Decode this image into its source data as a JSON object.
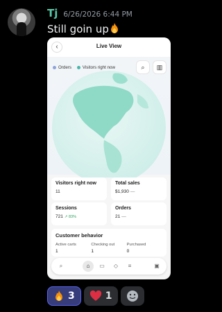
{
  "message": {
    "author": "Tj",
    "timestamp": "6/26/2026 6:44 PM",
    "text": "Still goin up",
    "emoji": "fire"
  },
  "screenshot": {
    "title": "Live View",
    "legend": [
      "Orders",
      "Visitors right now"
    ],
    "legend_colors": [
      "#8ea3d8",
      "#49b6a8"
    ],
    "cards": {
      "visitors": {
        "label": "Visitors right now",
        "value": "11"
      },
      "sales": {
        "label": "Total sales",
        "value": "$1,930",
        "trend": "—"
      },
      "sessions": {
        "label": "Sessions",
        "value": "721",
        "delta": "↗ 83%"
      },
      "orders": {
        "label": "Orders",
        "value": "21",
        "trend": "—"
      }
    },
    "behavior": {
      "title": "Customer behavior",
      "columns": [
        {
          "label": "Active carts",
          "value": "1"
        },
        {
          "label": "Checking out",
          "value": "1"
        },
        {
          "label": "Purchased",
          "value": "0"
        }
      ]
    },
    "nav_icons": [
      "search-icon",
      "home-icon",
      "inbox-icon",
      "tag-icon",
      "menu-icon",
      "store-icon"
    ]
  },
  "reactions": [
    {
      "emoji": "fire",
      "count": "3",
      "active": true
    },
    {
      "emoji": "red-heart",
      "count": "1",
      "active": false
    }
  ]
}
